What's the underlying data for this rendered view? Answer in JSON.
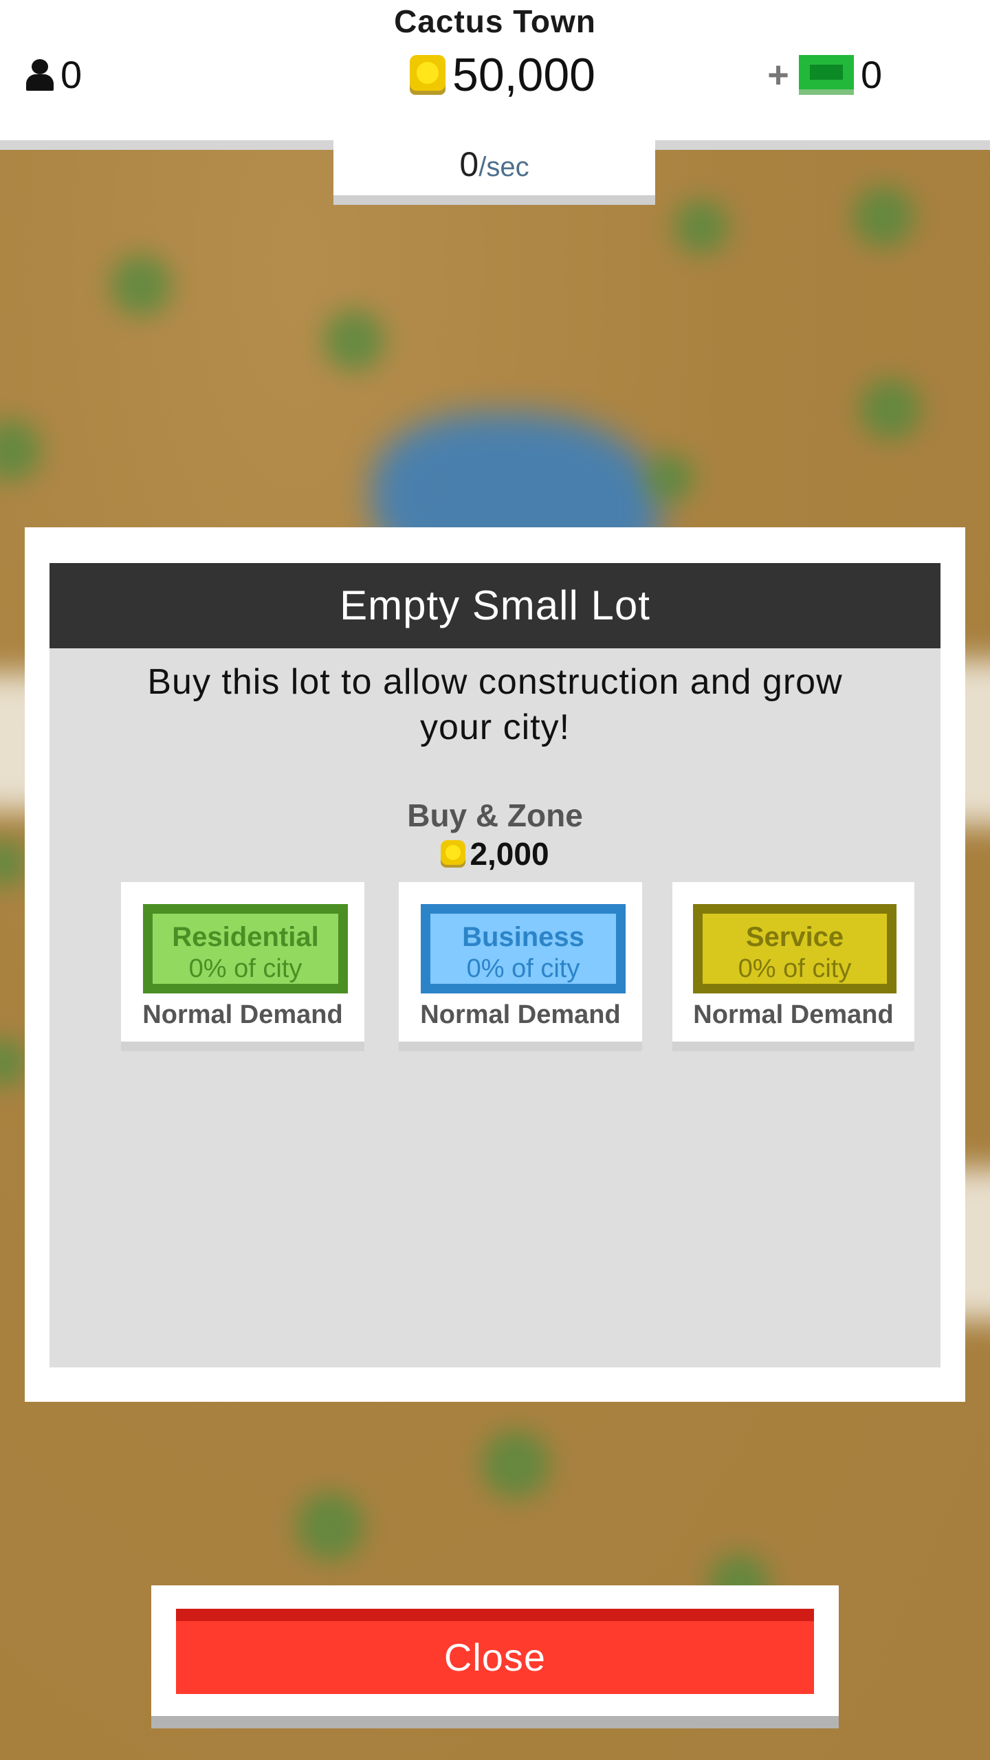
{
  "header": {
    "city_name": "Cactus Town",
    "population": "0",
    "coins": "50,000",
    "cash": "0",
    "rate_value": "0",
    "rate_unit": "/sec"
  },
  "icons": {
    "population": "person-icon",
    "coins": "coin-icon",
    "add_cash": "plus-icon",
    "cash": "bill-icon"
  },
  "dialog": {
    "title": "Empty Small Lot",
    "description": "Buy this lot to allow construction and grow your city!",
    "buy_label": "Buy & Zone",
    "price": "2,000",
    "zones": [
      {
        "name": "Residential",
        "share": "0% of city",
        "demand": "Normal Demand",
        "color": "#92d960"
      },
      {
        "name": "Business",
        "share": "0% of city",
        "demand": "Normal Demand",
        "color": "#82caff"
      },
      {
        "name": "Service",
        "share": "0% of city",
        "demand": "Normal Demand",
        "color": "#d8c81e"
      }
    ]
  },
  "footer": {
    "close_label": "Close",
    "close_color": "#ff3b2e"
  }
}
